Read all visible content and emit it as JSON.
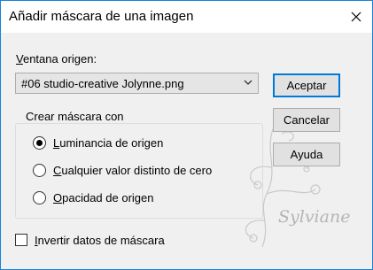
{
  "dialog": {
    "title": "Añadir máscara de una imagen"
  },
  "source": {
    "label_prefix": "",
    "label_access_key": "V",
    "label_rest": "entana origen:",
    "selected_value": "#06 studio-creative Jolynne.png"
  },
  "buttons": {
    "accept": "Aceptar",
    "cancel": "Cancelar",
    "help": "Ayuda"
  },
  "mask_group": {
    "legend": "Crear máscara con",
    "options": [
      {
        "access_key": "L",
        "rest": "uminancia de origen",
        "selected": true
      },
      {
        "access_key": "C",
        "rest": "ualquier valor distinto de cero",
        "selected": false
      },
      {
        "access_key": "O",
        "rest": "pacidad de origen",
        "selected": false
      }
    ]
  },
  "invert": {
    "access_key": "I",
    "rest": "nvertir datos de máscara",
    "checked": false
  },
  "watermark": {
    "text": "Sylviane"
  },
  "colors": {
    "accent": "#0078d7",
    "window_border": "#1883d7"
  },
  "icons": {
    "close": "close-icon",
    "dropdown": "chevron-down-icon"
  }
}
